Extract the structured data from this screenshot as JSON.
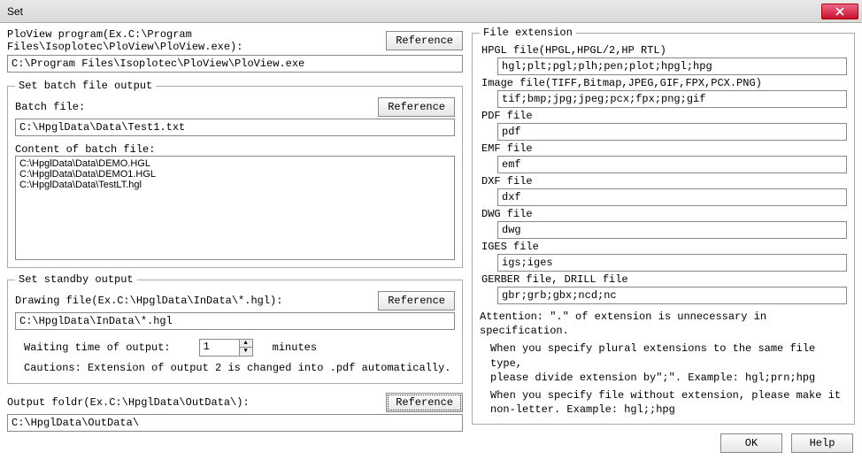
{
  "window": {
    "title": "Set"
  },
  "program": {
    "label": "PloView program(Ex.C:\\Program Files\\Isoplotec\\PloView\\PloView.exe):",
    "value": "C:\\Program Files\\Isoplotec\\PloView\\PloView.exe",
    "ref": "Reference"
  },
  "batch": {
    "legend": "Set batch file output",
    "file_label": "Batch file:",
    "file_value": "C:\\HpglData\\Data\\Test1.txt",
    "ref": "Reference",
    "content_label": "Content of batch file:",
    "content": "C:\\HpglData\\Data\\DEMO.HGL\nC:\\HpglData\\Data\\DEMO1.HGL\nC:\\HpglData\\Data\\TestLT.hgl"
  },
  "standby": {
    "legend": "Set standby output",
    "drawing_label": "Drawing file(Ex.C:\\HpglData\\InData\\*.hgl):",
    "drawing_value": "C:\\HpglData\\InData\\*.hgl",
    "ref": "Reference",
    "wait_label": "Waiting time of output:",
    "wait_value": "1",
    "wait_unit": "minutes",
    "caution": "Cautions: Extension of output 2 is changed into .pdf automatically."
  },
  "output": {
    "label": "Output foldr(Ex.C:\\HpglData\\OutData\\):",
    "value": "C:\\HpglData\\OutData\\",
    "ref": "Reference"
  },
  "ext": {
    "legend": "File extension",
    "hpgl_label": "HPGL file(HPGL,HPGL/2,HP RTL)",
    "hpgl_value": "hgl;plt;pgl;plh;pen;plot;hpgl;hpg",
    "img_label": "Image file(TIFF,Bitmap,JPEG,GIF,FPX,PCX.PNG)",
    "img_value": "tif;bmp;jpg;jpeg;pcx;fpx;png;gif",
    "pdf_label": "PDF file",
    "pdf_value": "pdf",
    "emf_label": "EMF file",
    "emf_value": "emf",
    "dxf_label": "DXF file",
    "dxf_value": "dxf",
    "dwg_label": "DWG file",
    "dwg_value": "dwg",
    "iges_label": "IGES file",
    "iges_value": "igs;iges",
    "gerber_label": "GERBER file, DRILL file",
    "gerber_value": "gbr;grb;gbx;ncd;nc",
    "attn1": "Attention: \".\" of extension is unnecessary in specification.",
    "attn2a": "When you specify plural extensions to the same file type,",
    "attn2b": "please divide extension by\";\".    Example:   hgl;prn;hpg",
    "attn3a": "When you specify file without extension, please make it",
    "attn3b": "non-letter.                       Example:   hgl;;hpg"
  },
  "buttons": {
    "ok": "OK",
    "help": "Help"
  }
}
